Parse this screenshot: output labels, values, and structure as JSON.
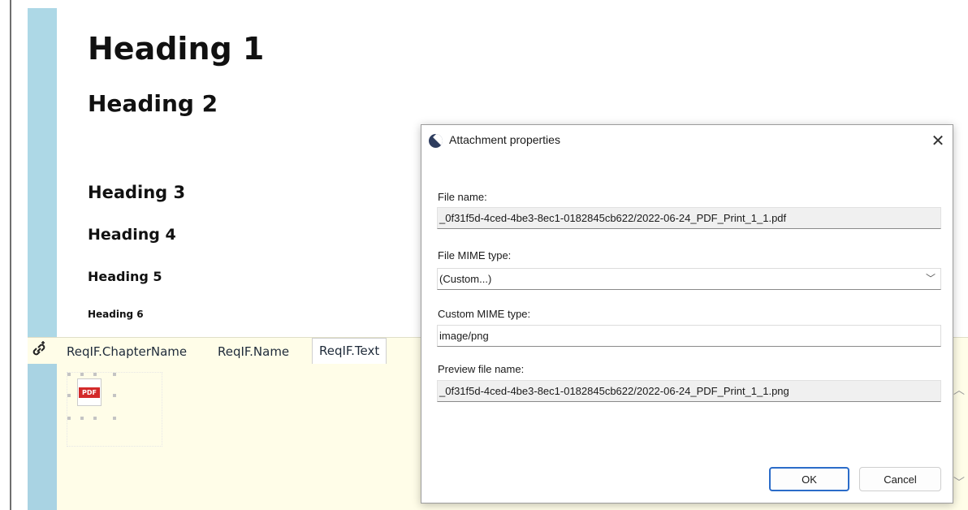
{
  "document": {
    "headings": {
      "h1": "Heading 1",
      "h2": "Heading 2",
      "h3": "Heading 3",
      "h4": "Heading 4",
      "h5": "Heading 5",
      "h6": "Heading 6"
    }
  },
  "attribute_panel": {
    "link_icon": "link-icon",
    "tabs": [
      {
        "label": "ReqIF.ChapterName",
        "active": false
      },
      {
        "label": "ReqIF.Name",
        "active": false
      },
      {
        "label": "ReqIF.Text",
        "active": true
      }
    ],
    "attachment": {
      "icon": "pdf-file-icon",
      "badge": "PDF"
    }
  },
  "dialog": {
    "title": "Attachment properties",
    "close_glyph": "✕",
    "file_name_label": "File name:",
    "file_name_value": "_0f31f5d-4ced-4be3-8ec1-0182845cb622/2022-06-24_PDF_Print_1_1.pdf",
    "mime_type_label": "File MIME type:",
    "mime_type_value": "(Custom...)",
    "custom_mime_label": "Custom MIME type:",
    "custom_mime_value": "image/png",
    "preview_name_label": "Preview file name:",
    "preview_name_value": "_0f31f5d-4ced-4be3-8ec1-0182845cb622/2022-06-24_PDF_Print_1_1.png",
    "ok_label": "OK",
    "cancel_label": "Cancel"
  },
  "colors": {
    "left_band": "#add8e6",
    "panel_background": "#fffde8",
    "ok_border": "#2b6cc9",
    "pdf_badge": "#d32a2a"
  }
}
